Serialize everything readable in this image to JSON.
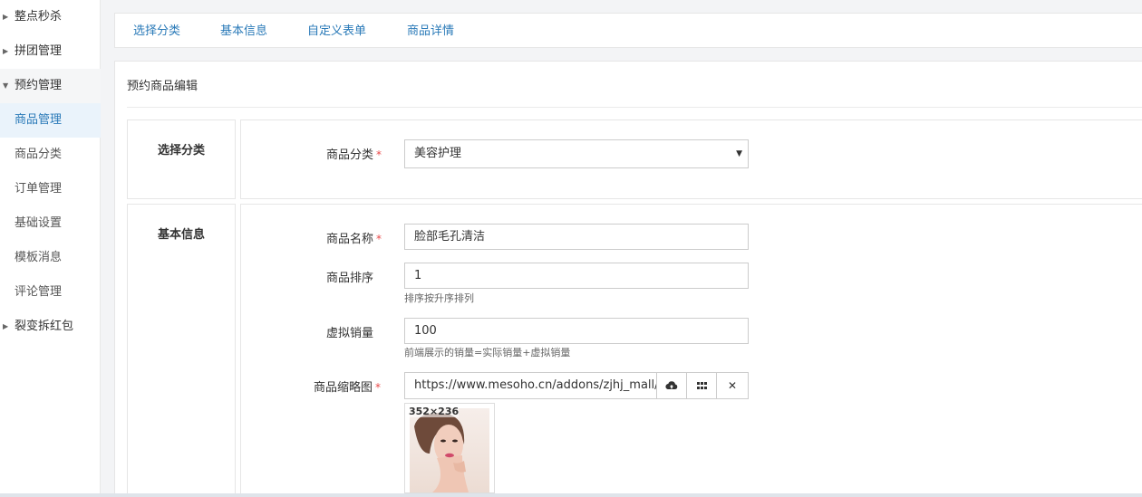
{
  "sidebar": {
    "items": [
      {
        "label": "整点秒杀",
        "arrow": "▶"
      },
      {
        "label": "拼团管理",
        "arrow": "▶"
      },
      {
        "label": "预约管理",
        "arrow": "▼"
      },
      {
        "label": "商品管理"
      },
      {
        "label": "商品分类"
      },
      {
        "label": "订单管理"
      },
      {
        "label": "基础设置"
      },
      {
        "label": "模板消息"
      },
      {
        "label": "评论管理"
      },
      {
        "label": "裂变拆红包",
        "arrow": "▶"
      }
    ]
  },
  "tabs": [
    {
      "label": "选择分类"
    },
    {
      "label": "基本信息"
    },
    {
      "label": "自定义表单"
    },
    {
      "label": "商品详情"
    }
  ],
  "panel": {
    "title": "预约商品编辑"
  },
  "category_section": {
    "label": "选择分类",
    "field_label": "商品分类",
    "required_mark": "*",
    "selected": "美容护理",
    "caret": "▼"
  },
  "basic_section": {
    "label": "基本信息",
    "name": {
      "label": "商品名称",
      "required_mark": "*",
      "value": "脸部毛孔清洁"
    },
    "sort": {
      "label": "商品排序",
      "value": "1",
      "help": "排序按升序排列"
    },
    "virtual_sales": {
      "label": "虚拟销量",
      "value": "100",
      "help": "前端展示的销量=实际销量+虚拟销量"
    },
    "thumbnail": {
      "label": "商品缩略图",
      "required_mark": "*",
      "value": "https://www.mesoho.cn/addons/zjhj_mall/",
      "upload_icon": "cloud-upload-icon",
      "gallery_icon": "grid-icon",
      "clear_glyph": "✕",
      "size_text": "352×236"
    }
  },
  "colors": {
    "accent": "#2a7ab8",
    "required": "#e94a4a",
    "active_bg": "#eaf3fb"
  }
}
